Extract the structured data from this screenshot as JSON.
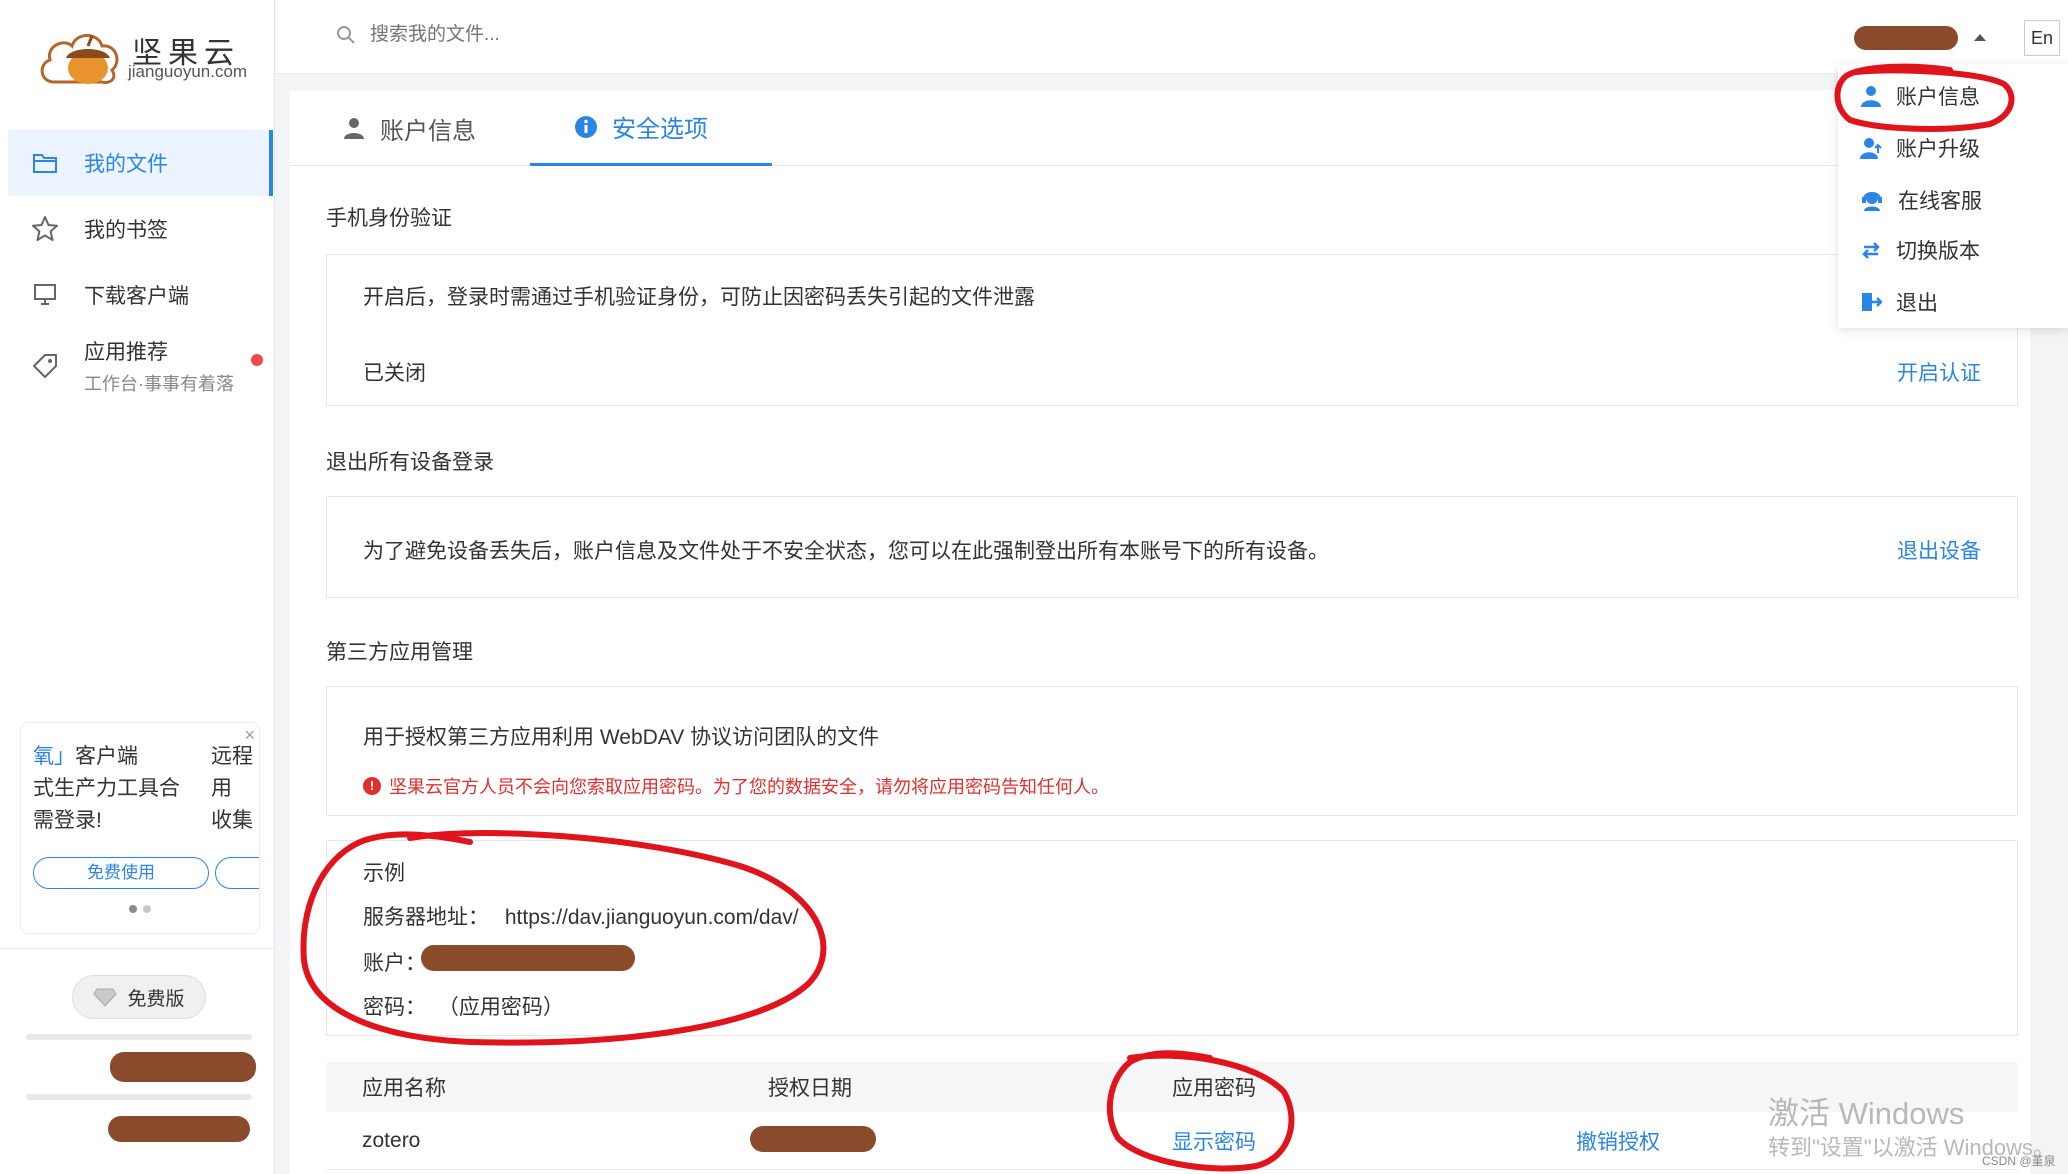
{
  "app": {
    "logo_cn": "坚果云",
    "logo_en": "jianguoyun.com"
  },
  "sidebar": {
    "items": [
      {
        "label": "我的文件",
        "active": true
      },
      {
        "label": "我的书签"
      },
      {
        "label": "下载客户端"
      },
      {
        "label": "应用推荐",
        "sub": "工作台·事事有着落"
      }
    ],
    "promo": {
      "col1_line1_hl": "氧」",
      "col1_line1_rest": "客户端",
      "col1_line2": "式生产力工具合",
      "col1_line3": "需登录!",
      "col2_line1": "远程",
      "col2_line2": "用",
      "col2_line3": "收集",
      "close": "×",
      "button": "免费使用"
    },
    "plan_label": "免费版"
  },
  "topbar": {
    "search_placeholder": "搜索我的文件...",
    "lang": "En"
  },
  "tabs": [
    {
      "label": "账户信息"
    },
    {
      "label": "安全选项",
      "active": true
    }
  ],
  "phone_auth": {
    "title": "手机身份验证",
    "desc": "开启后，登录时需通过手机验证身份，可防止因密码丢失引起的文件泄露",
    "status": "已关闭",
    "action": "开启认证"
  },
  "logout_all": {
    "title": "退出所有设备登录",
    "desc": "为了避免设备丢失后，账户信息及文件处于不安全状态，您可以在此强制登出所有本账号下的所有设备。",
    "action": "退出设备"
  },
  "third_party": {
    "title": "第三方应用管理",
    "desc": "用于授权第三方应用利用 WebDAV 协议访问团队的文件",
    "warning": "坚果云官方人员不会向您索取应用密码。为了您的数据安全，请勿将应用密码告知任何人。",
    "example": {
      "title": "示例",
      "server_label": "服务器地址：",
      "server_value": "https://dav.jianguoyun.com/dav/",
      "account_label": "账户：",
      "password_label": "密码：",
      "password_value": "（应用密码）"
    },
    "table": {
      "headers": [
        "应用名称",
        "授权日期",
        "应用密码"
      ],
      "rows": [
        {
          "name": "zotero",
          "password_action": "显示密码",
          "revoke": "撤销授权"
        }
      ]
    }
  },
  "user_menu": {
    "items": [
      {
        "label": "账户信息",
        "icon": "user-icon"
      },
      {
        "label": "账户升级",
        "icon": "user-upgrade-icon"
      },
      {
        "label": "在线客服",
        "icon": "support-icon"
      },
      {
        "label": "切换版本",
        "icon": "switch-icon"
      },
      {
        "label": "退出",
        "icon": "logout-icon"
      }
    ]
  },
  "watermark": {
    "line1": "激活 Windows",
    "line2": "转到\"设置\"以激活 Windows。",
    "credit": "CSDN @堇泉"
  },
  "colors": {
    "accent": "#2b85e4",
    "warning": "#e0302d",
    "annotation": "#e0141c",
    "redaction": "#8a4a2c"
  }
}
